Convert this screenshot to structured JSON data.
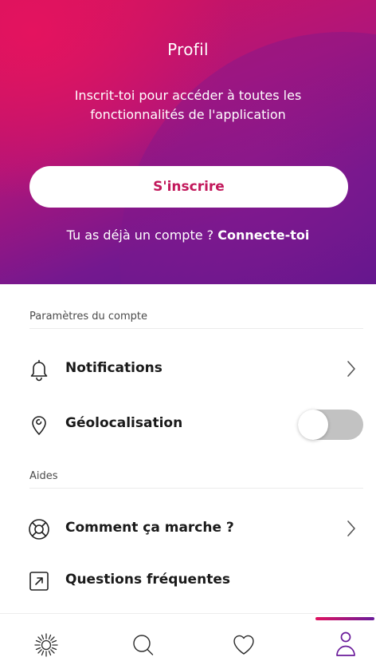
{
  "hero": {
    "title": "Profil",
    "subtitle": "Inscrit-toi pour accéder à toutes les fonctionnalités de l'application",
    "signup_label": "S'inscrire",
    "login_prompt": "Tu as déjà un compte ? ",
    "login_link": "Connecte-toi"
  },
  "sections": {
    "account": {
      "header": "Paramètres du compte",
      "notifications_label": "Notifications",
      "geolocation_label": "Géolocalisation",
      "geolocation_enabled": false
    },
    "help": {
      "header": "Aides",
      "how_it_works_label": "Comment ça marche ?",
      "faq_label": "Questions fréquentes"
    }
  },
  "tabbar": {
    "tabs": [
      "sun-icon",
      "search-icon",
      "heart-icon",
      "profile-icon"
    ],
    "active": "profile-icon"
  },
  "colors": {
    "accent_pink": "#c2185b",
    "gradient_start": "#e4135f",
    "gradient_end": "#5a178f",
    "toggle_off": "#c2c2c2"
  }
}
